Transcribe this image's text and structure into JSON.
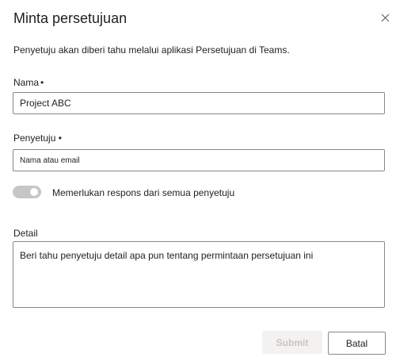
{
  "dialog": {
    "title": "Minta persetujuan",
    "description": "Penyetuju akan diberi tahu melalui aplikasi Persetujuan di Teams.",
    "close_icon": "close-icon"
  },
  "name_field": {
    "label": "Nama",
    "required_marker": "•",
    "value": "Project ABC"
  },
  "approver_field": {
    "label": "Penyetuju",
    "required_marker": "•",
    "placeholder": "Nama atau email"
  },
  "toggle": {
    "label": "Memerlukan respons dari semua penyetuju",
    "state": "on",
    "disabled": true
  },
  "detail_field": {
    "label": "Detail",
    "placeholder": "Beri tahu penyetuju detail apa pun tentang permintaan persetujuan ini"
  },
  "buttons": {
    "submit_label": "Submit",
    "cancel_label": "Batal"
  },
  "colors": {
    "border": "#8a8886",
    "disabled_bg": "#f3f2f1",
    "disabled_text": "#c8c6c4",
    "text": "#201f1e"
  }
}
